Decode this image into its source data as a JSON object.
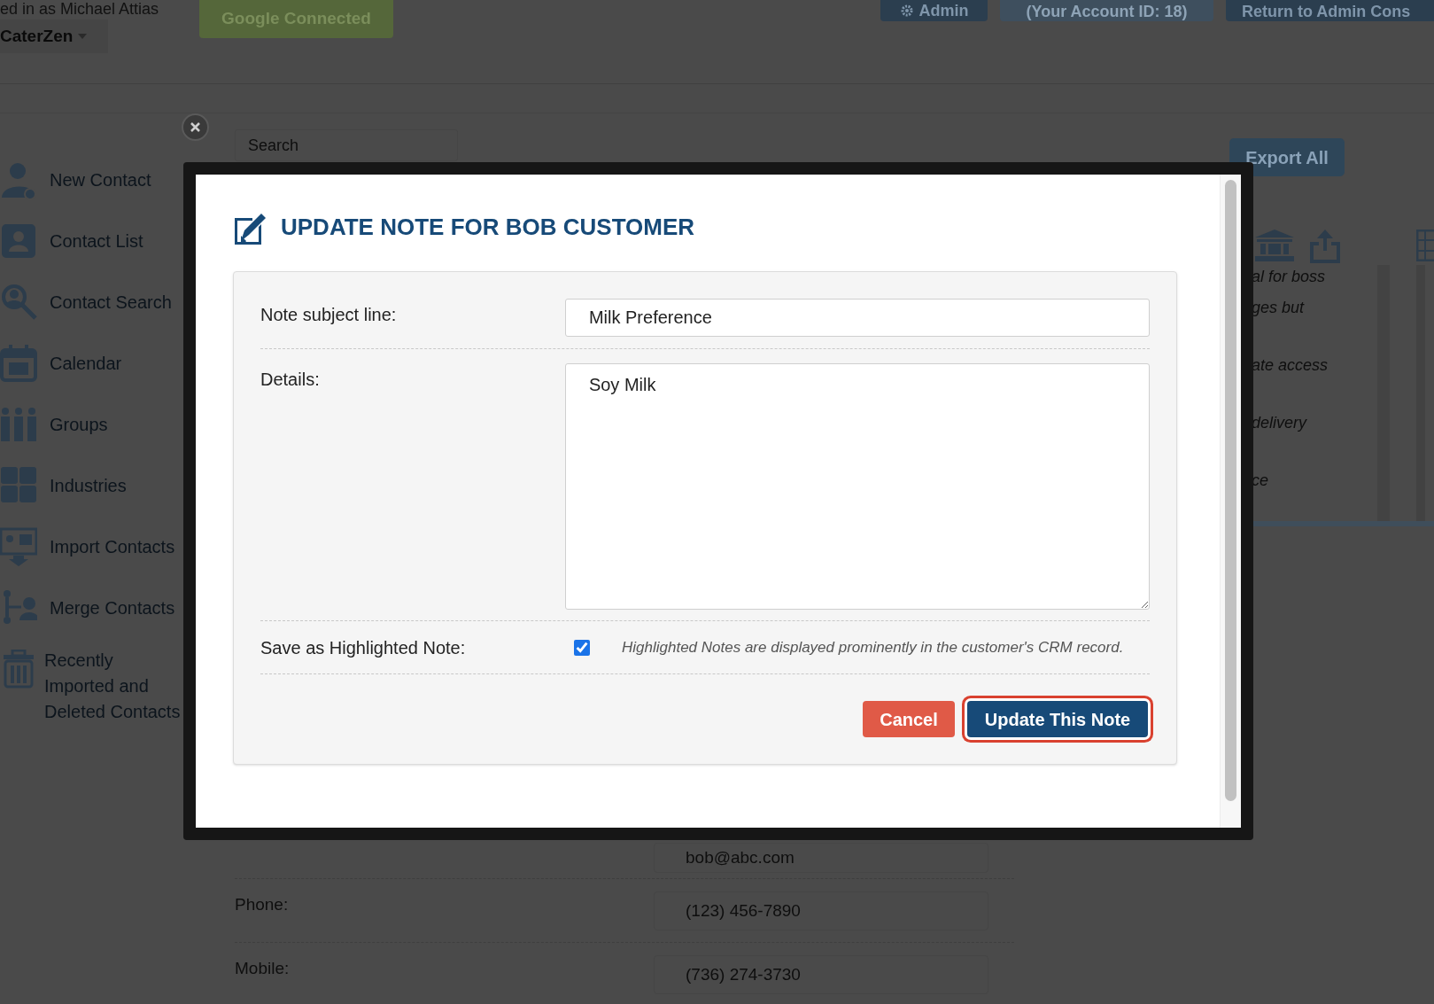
{
  "header": {
    "login_text": "ed in as Michael Attias",
    "brand_menu": "CaterZen",
    "google_button": "Google Connected",
    "admin_button": "Admin",
    "account_button": "(Your Account ID: 18)",
    "return_button": "Return to Admin Cons"
  },
  "search": {
    "placeholder": "Search"
  },
  "export_button": "Export All",
  "sidebar": {
    "items": [
      {
        "label": "New Contact"
      },
      {
        "label": "Contact List"
      },
      {
        "label": "Contact Search"
      },
      {
        "label": "Calendar"
      },
      {
        "label": "Groups"
      },
      {
        "label": "Industries"
      },
      {
        "label": "Import Contacts"
      },
      {
        "label": "Merge Contacts"
      },
      {
        "label": "Recently Imported and Deleted Contacts"
      }
    ]
  },
  "note_fragments": [
    "al for boss",
    "ges but",
    "ate access",
    "delivery",
    "ce"
  ],
  "contact_fields": [
    {
      "value": "bob@abc.com"
    },
    {
      "label": "Phone:",
      "value": "(123) 456-7890"
    },
    {
      "label": "Mobile:",
      "value": "(736) 274-3730"
    }
  ],
  "modal": {
    "title": "UPDATE NOTE FOR BOB CUSTOMER",
    "subject_label": "Note subject line:",
    "subject_value": "Milk Preference",
    "details_label": "Details:",
    "details_value": "Soy Milk",
    "highlight_label": "Save as Highlighted Note:",
    "highlight_checked": true,
    "highlight_hint": "Highlighted Notes are displayed prominently in the customer's CRM record.",
    "cancel_button": "Cancel",
    "submit_button": "Update This Note"
  }
}
